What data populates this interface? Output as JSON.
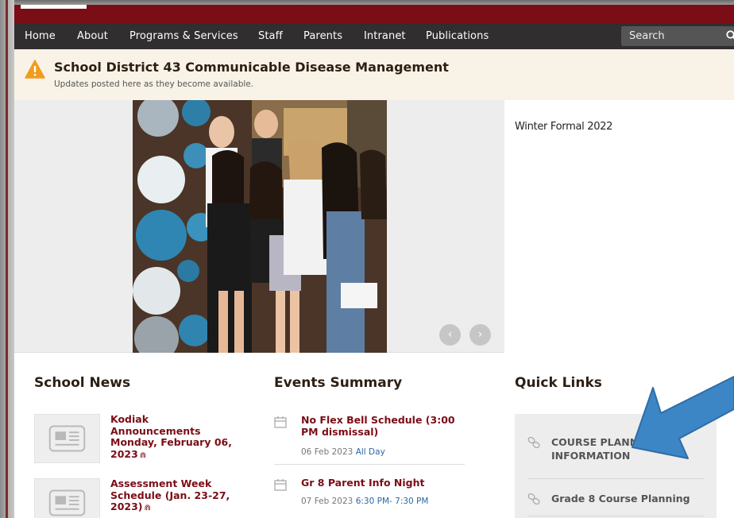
{
  "nav": {
    "items": [
      "Home",
      "About",
      "Programs & Services",
      "Staff",
      "Parents",
      "Intranet",
      "Publications"
    ],
    "search_placeholder": "Search"
  },
  "alert": {
    "title": "School District 43 Communicable Disease Management",
    "subtitle": "Updates posted here as they become available."
  },
  "slider": {
    "caption": "Winter Formal 2022",
    "prev_label": "‹",
    "next_label": "›"
  },
  "school_news": {
    "heading": "School News",
    "items": [
      {
        "title": "Kodiak Announcements Monday, February 06, 2023",
        "attachment": "⋒"
      },
      {
        "title": "Assessment Week Schedule (Jan. 23-27, 2023)",
        "attachment": "⋒"
      }
    ]
  },
  "events": {
    "heading": "Events Summary",
    "items": [
      {
        "title": "No Flex Bell Schedule (3:00 PM dismissal)",
        "date": "06 Feb 2023",
        "time": "All Day"
      },
      {
        "title": "Gr 8 Parent Info Night",
        "date": "07 Feb 2023",
        "time": "6:30 PM- 7:30 PM"
      }
    ]
  },
  "quick_links": {
    "heading": "Quick Links",
    "items": [
      {
        "label_line1": "COURSE PLANNI",
        "label_line2": "INFORMATION"
      },
      {
        "label_line1": "Grade 8 Course Planning"
      }
    ]
  },
  "colors": {
    "brand_maroon": "#7b0d16",
    "nav_bg": "#302e2e",
    "alert_bg": "#f8f3e6",
    "alert_icon": "#f29b1d",
    "arrow_blue": "#3d86c6",
    "link_blue": "#2b67a8"
  },
  "icons": [
    "warning-icon",
    "search-icon",
    "chevron-left-icon",
    "chevron-right-icon",
    "news-thumbnail-icon",
    "calendar-icon",
    "link-icon",
    "paperclip-icon",
    "arrow-annotation"
  ]
}
